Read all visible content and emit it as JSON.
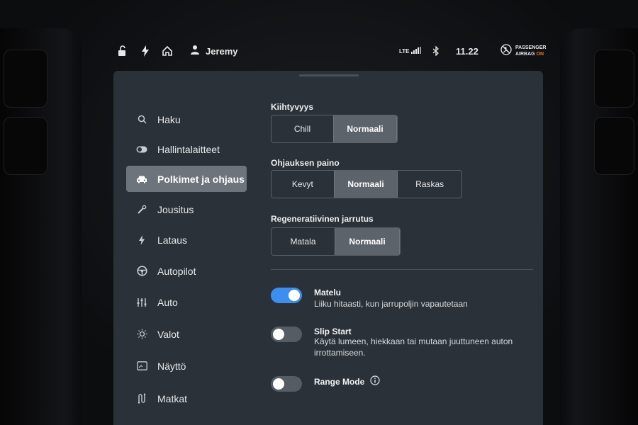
{
  "status_bar": {
    "lock_icon": "unlock-icon",
    "bolt_icon": "bolt-icon",
    "home_icon": "home-icon",
    "user_icon": "person-icon",
    "user_name": "Jeremy",
    "network": "LTE",
    "bluetooth_icon": "bluetooth-icon",
    "time": "11.22",
    "airbag_line1": "PASSENGER",
    "airbag_line2": "AIRBAG",
    "airbag_state": "ON",
    "airbag_state_color": "#e9752b"
  },
  "sidebar": {
    "items": [
      {
        "label": "Haku",
        "icon": "search-icon"
      },
      {
        "label": "Hallintalaitteet",
        "icon": "toggle-icon"
      },
      {
        "label": "Polkimet ja ohjaus",
        "icon": "car-icon",
        "active": true
      },
      {
        "label": "Jousitus",
        "icon": "wrench-icon"
      },
      {
        "label": "Lataus",
        "icon": "bolt-icon"
      },
      {
        "label": "Autopilot",
        "icon": "steering-wheel-icon"
      },
      {
        "label": "Auto",
        "icon": "sliders-icon"
      },
      {
        "label": "Valot",
        "icon": "sun-icon"
      },
      {
        "label": "Näyttö",
        "icon": "display-icon"
      },
      {
        "label": "Matkat",
        "icon": "route-icon"
      }
    ]
  },
  "acceleration": {
    "label": "Kiihtyvyys",
    "options": [
      "Chill",
      "Normaali"
    ],
    "selected": "Normaali"
  },
  "steering": {
    "label": "Ohjauksen paino",
    "options": [
      "Kevyt",
      "Normaali",
      "Raskas"
    ],
    "selected": "Normaali"
  },
  "regen": {
    "label": "Regeneratiivinen jarrutus",
    "options": [
      "Matala",
      "Normaali"
    ],
    "selected": "Normaali"
  },
  "creep": {
    "title": "Matelu",
    "description": "Liiku hitaasti, kun jarrupoljin vapautetaan",
    "enabled": true
  },
  "slip_start": {
    "title": "Slip Start",
    "description": "Käytä lumeen, hiekkaan tai mutaan juuttuneen auton irrottamiseen.",
    "enabled": false
  },
  "range_mode": {
    "title": "Range Mode",
    "info_icon": "info-icon",
    "enabled": false
  },
  "colors": {
    "accent": "#3e8ef0",
    "panel_bg": "#2b3138",
    "selected_bg": "#5d636a",
    "active_nav_bg": "#6e747b"
  }
}
